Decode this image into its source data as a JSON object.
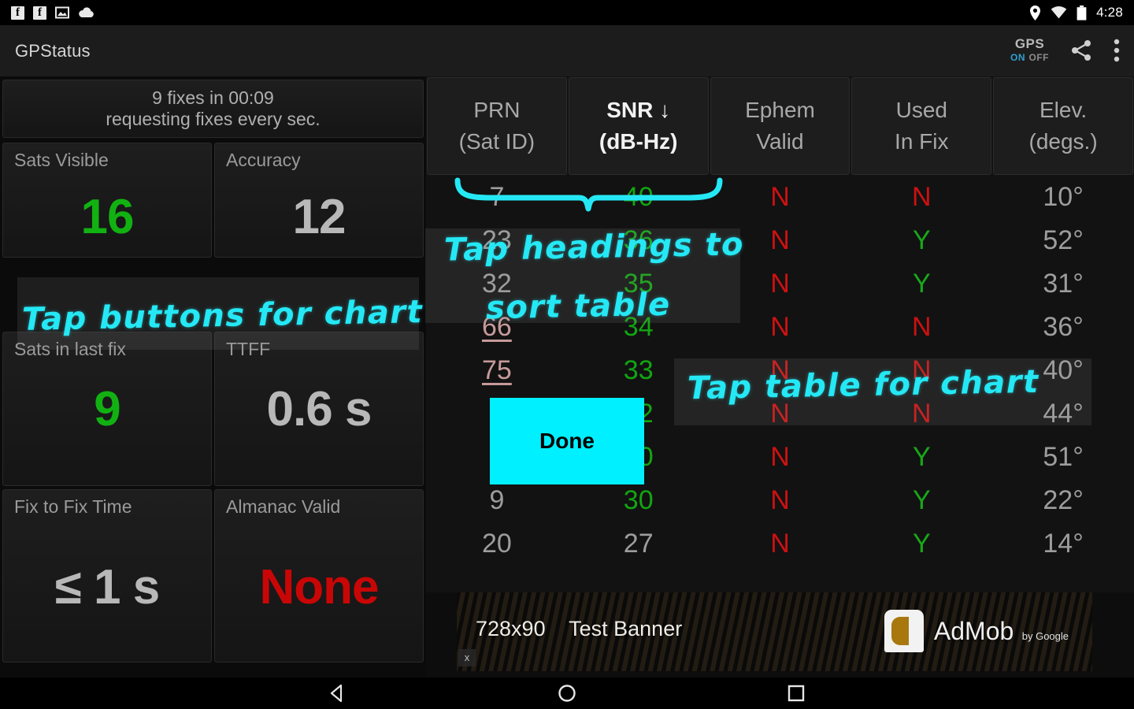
{
  "statusbar": {
    "icons": [
      "facebook-icon",
      "facebook-icon",
      "photo-icon",
      "cloud-upload-icon"
    ],
    "location_icon": "location-pin-icon",
    "wifi_icon": "wifi-icon",
    "battery_icon": "battery-icon",
    "clock": "4:28"
  },
  "actionbar": {
    "title": "GPStatus",
    "gps_label": "GPS",
    "gps_on": "ON",
    "gps_off": "OFF",
    "share_icon": "share-icon",
    "overflow_icon": "overflow-menu-icon"
  },
  "dashboard": {
    "banner_line1": "9 fixes in 00:09",
    "banner_line2": "requesting fixes every sec.",
    "cards": [
      {
        "label": "Sats Visible",
        "value": "16",
        "color": "#12b112"
      },
      {
        "label": "Accuracy",
        "value": "12",
        "color": "#b8b8b8"
      },
      {
        "label": "Sats in last fix",
        "value": "9",
        "color": "#12b112"
      },
      {
        "label": "TTFF",
        "value": "0.6 s",
        "color": "#b8b8b8"
      },
      {
        "label": "Fix to Fix Time",
        "value": "≤ 1 s",
        "color": "#b8b8b8"
      },
      {
        "label": "Almanac Valid",
        "value": "None",
        "color": "#c90606"
      }
    ]
  },
  "table": {
    "sort_column": "SNR",
    "sort_direction": "↓",
    "headers": [
      {
        "line1": "PRN",
        "line2": "(Sat ID)",
        "sorted": false
      },
      {
        "line1": "SNR ↓",
        "line2": "(dB-Hz)",
        "sorted": true
      },
      {
        "line1": "Ephem",
        "line2": "Valid",
        "sorted": false
      },
      {
        "line1": "Used",
        "line2": "In Fix",
        "sorted": false
      },
      {
        "line1": "Elev.",
        "line2": "(degs.)",
        "sorted": false
      }
    ],
    "rows": [
      {
        "prn": "7",
        "sbas": false,
        "snr": "40",
        "snr_high": true,
        "ephem": "N",
        "used": "N",
        "elev": "10°"
      },
      {
        "prn": "23",
        "sbas": false,
        "snr": "36",
        "snr_high": true,
        "ephem": "N",
        "used": "Y",
        "elev": "52°"
      },
      {
        "prn": "32",
        "sbas": false,
        "snr": "35",
        "snr_high": true,
        "ephem": "N",
        "used": "Y",
        "elev": "31°"
      },
      {
        "prn": "66",
        "sbas": true,
        "snr": "34",
        "snr_high": true,
        "ephem": "N",
        "used": "N",
        "elev": "36°"
      },
      {
        "prn": "75",
        "sbas": true,
        "snr": "33",
        "snr_high": true,
        "ephem": "N",
        "used": "N",
        "elev": "40°"
      },
      {
        "prn": "",
        "sbas": true,
        "snr": "32",
        "snr_high": true,
        "ephem": "N",
        "used": "N",
        "elev": "44°"
      },
      {
        "prn": "",
        "sbas": true,
        "snr": "30",
        "snr_high": true,
        "ephem": "N",
        "used": "Y",
        "elev": "51°"
      },
      {
        "prn": "9",
        "sbas": false,
        "snr": "30",
        "snr_high": true,
        "ephem": "N",
        "used": "Y",
        "elev": "22°"
      },
      {
        "prn": "20",
        "sbas": false,
        "snr": "27",
        "snr_high": false,
        "ephem": "N",
        "used": "Y",
        "elev": "14°"
      }
    ]
  },
  "annotations": {
    "tap_buttons": "Tap buttons for chart",
    "tap_headings_line1": "Tap headings to",
    "tap_headings_line2": "sort table",
    "tap_table": "Tap table for chart"
  },
  "done_button": {
    "label": "Done"
  },
  "ad": {
    "size_text": "728x90",
    "banner_text": "Test Banner",
    "brand": "AdMob",
    "by": "by Google",
    "close_label": "x"
  },
  "navbar": {
    "back_icon": "back-triangle-icon",
    "home_icon": "home-circle-icon",
    "recents_icon": "recents-square-icon"
  }
}
